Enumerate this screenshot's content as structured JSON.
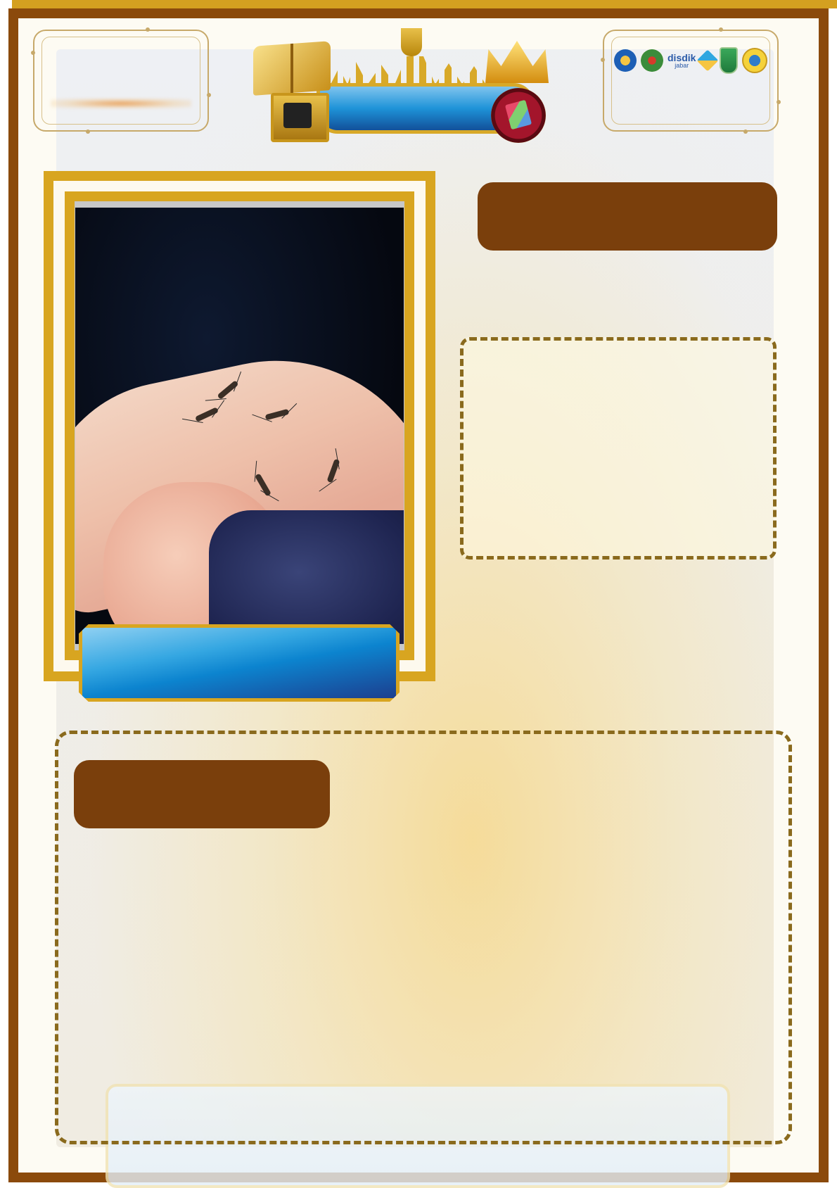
{
  "header": {
    "logos": {
      "disdik_main": "disdik",
      "disdik_sub": "jabar",
      "icons": [
        "emblem-1-icon",
        "emblem-2-icon",
        "disdik-jabar-icon",
        "diamond-icon",
        "tower-icon",
        "emblem-6-icon"
      ]
    },
    "emblem_icons": [
      "book-icon",
      "trophy-icon",
      "crown-icon",
      "medal-icon"
    ]
  },
  "photo": {
    "subject": "mosquito-on-arm-photo"
  },
  "colors": {
    "frame_brown": "#8b4a0c",
    "gold": "#d8a520",
    "pill_brown": "#7a3f0c",
    "dash": "#8a6a1d",
    "banner_blue": "#0c84cf"
  }
}
